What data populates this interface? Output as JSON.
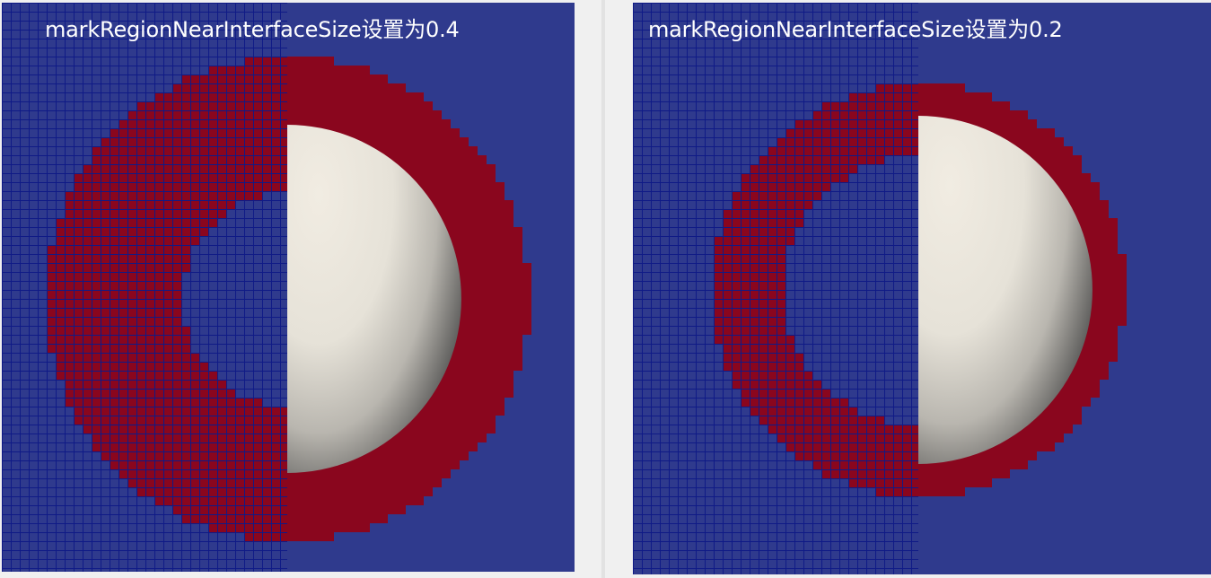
{
  "panels": [
    {
      "caption": "markRegionNearInterfaceSize设置为0.4",
      "mark_size": 0.4
    },
    {
      "caption": "markRegionNearInterfaceSize设置为0.2",
      "mark_size": 0.2
    }
  ],
  "colors": {
    "background_cells": "#2f3a8d",
    "grid_lines": "#0f1a86",
    "marked_region": "#8a061e",
    "sphere_light": "#f1ece2",
    "sphere_dark": "#4a4a4a"
  }
}
